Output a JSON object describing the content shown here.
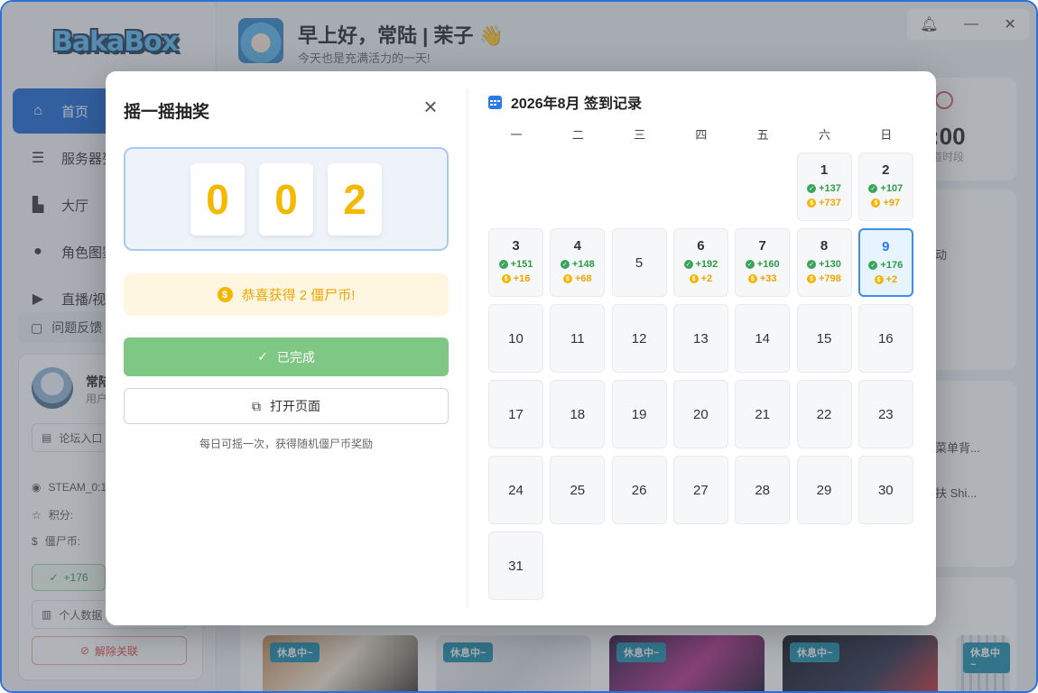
{
  "app": {
    "logo": "BakaBox"
  },
  "sidebar": {
    "items": [
      {
        "label": "首页",
        "icon": "home-icon"
      },
      {
        "label": "服务器列",
        "icon": "server-icon"
      },
      {
        "label": "大厅",
        "icon": "city-icon"
      },
      {
        "label": "角色图鉴",
        "icon": "users-icon"
      },
      {
        "label": "直播/视",
        "icon": "play-icon"
      }
    ],
    "feedback": "问题反馈",
    "user": {
      "name": "常陆",
      "role": "用户",
      "forum": "论坛入口",
      "steam": "STEAM_0:1",
      "points_label": "积分:",
      "coins_label": "僵尸币:",
      "checkin": "+176",
      "profile": "个人数据",
      "unlink": "解除关联"
    }
  },
  "header": {
    "greeting": "早上好，常陆 | 茉子 👋",
    "subtitle": "今天也是充满活力的一天!"
  },
  "bg": {
    "clock_time": ":00",
    "clock_sub": "道时段",
    "side1": "动",
    "side2": "菜单背...",
    "side3": "扶 Shi...",
    "thumb_tag": "休息中~"
  },
  "lottery": {
    "title": "摇一摇抽奖",
    "digits": [
      "0",
      "0",
      "2"
    ],
    "prize": "恭喜获得 2 僵尸币!",
    "done": "已完成",
    "open": "打开页面",
    "hint": "每日可摇一次，获得随机僵尸币奖励"
  },
  "calendar": {
    "title": "2026年8月 签到记录",
    "weekdays": [
      "一",
      "二",
      "三",
      "四",
      "五",
      "六",
      "日"
    ],
    "days": [
      {
        "day": "1",
        "points": "+137",
        "coins": "+737"
      },
      {
        "day": "2",
        "points": "+107",
        "coins": "+97"
      },
      {
        "day": "3",
        "points": "+151",
        "coins": "+16"
      },
      {
        "day": "4",
        "points": "+148",
        "coins": "+68"
      },
      {
        "day": "5"
      },
      {
        "day": "6",
        "points": "+192",
        "coins": "+2"
      },
      {
        "day": "7",
        "points": "+160",
        "coins": "+33"
      },
      {
        "day": "8",
        "points": "+130",
        "coins": "+798"
      },
      {
        "day": "9",
        "points": "+176",
        "coins": "+2",
        "today": true
      },
      {
        "day": "10"
      },
      {
        "day": "11"
      },
      {
        "day": "12"
      },
      {
        "day": "13"
      },
      {
        "day": "14"
      },
      {
        "day": "15"
      },
      {
        "day": "16"
      },
      {
        "day": "17"
      },
      {
        "day": "18"
      },
      {
        "day": "19"
      },
      {
        "day": "20"
      },
      {
        "day": "21"
      },
      {
        "day": "22"
      },
      {
        "day": "23"
      },
      {
        "day": "24"
      },
      {
        "day": "25"
      },
      {
        "day": "26"
      },
      {
        "day": "27"
      },
      {
        "day": "28"
      },
      {
        "day": "29"
      },
      {
        "day": "30"
      },
      {
        "day": "31"
      }
    ],
    "first_weekday_index": 5
  },
  "colors": {
    "accent": "#1a66d6",
    "gold": "#f5b800",
    "done_green": "#7fc785",
    "today_border": "#3d8ee6"
  }
}
